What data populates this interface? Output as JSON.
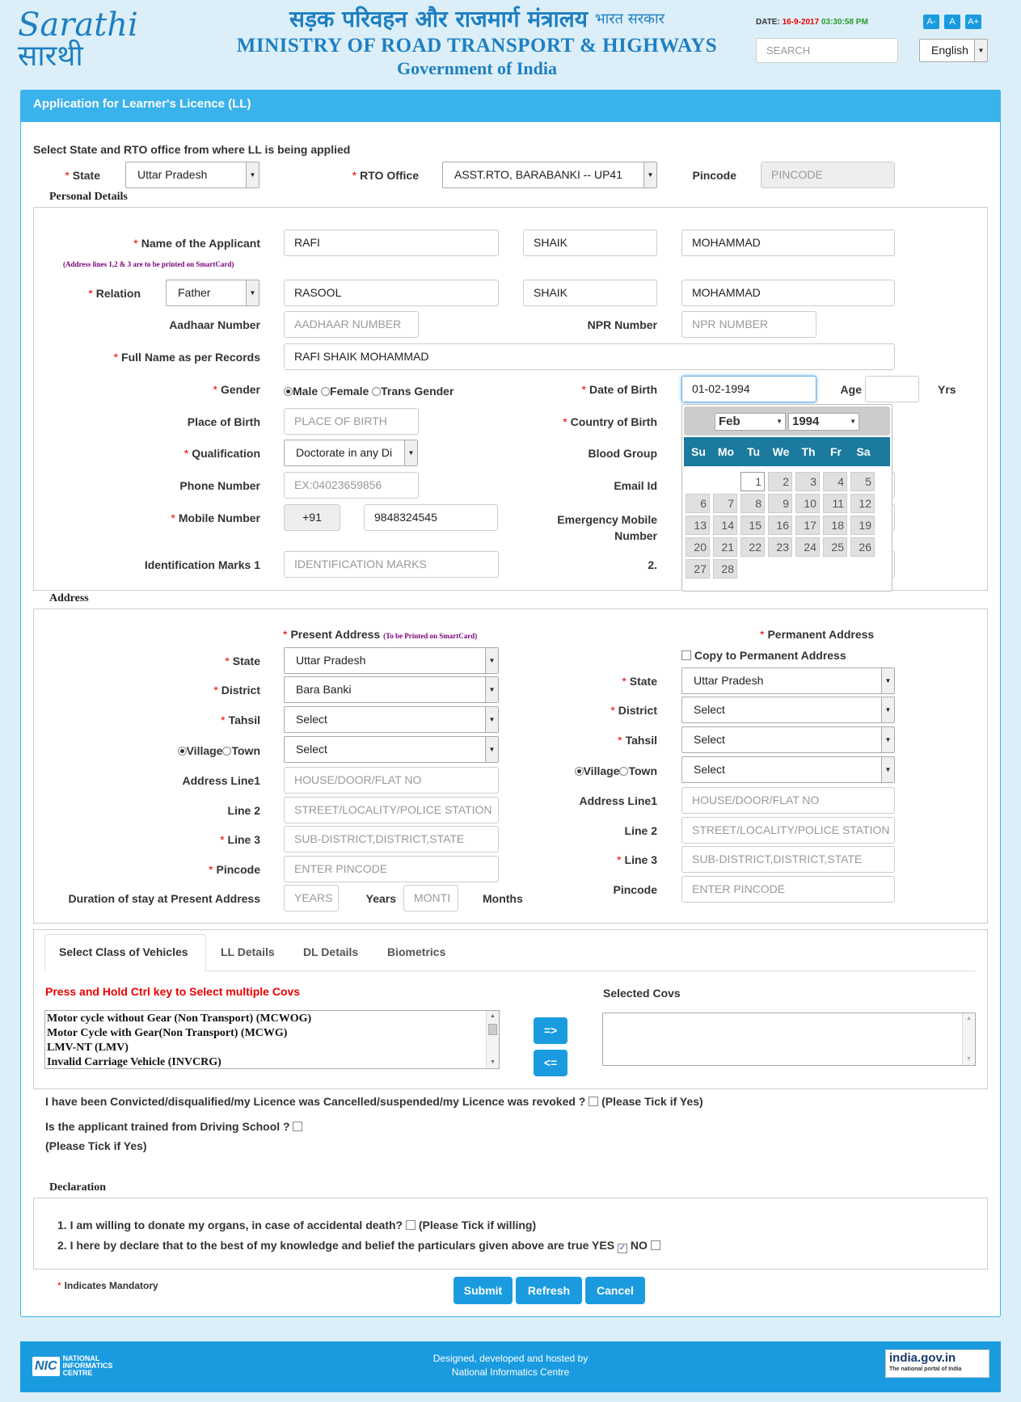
{
  "header": {
    "logo_latin": "Sarathi",
    "logo_hindi": "सारथी",
    "hindi_title": "सड़क परिवहन और राजमार्ग मंत्रालय",
    "hindi_gov": "भारत सरकार",
    "ministry": "MINISTRY OF ROAD TRANSPORT & HIGHWAYS",
    "gov": "Government of India",
    "date_label": "DATE:",
    "date_value": "16-9-2017",
    "time_value": "03:30:58 PM",
    "font_a_minus": "A-",
    "font_a": "A",
    "font_a_plus": "A+",
    "search_placeholder": "SEARCH",
    "language": "English"
  },
  "panel_title": "Application for Learner's Licence (LL)",
  "intro": "Select State and RTO office from where LL is being applied",
  "state_label": "State",
  "state_value": "Uttar Pradesh",
  "rto_label": "RTO Office",
  "rto_value": "ASST.RTO, BARABANKI -- UP41",
  "pincode_label": "Pincode",
  "pincode_placeholder": "PINCODE",
  "personal": {
    "legend": "Personal Details",
    "name_label": "Name of the Applicant",
    "name_note": "(Address lines 1,2 & 3 are to be printed on SmartCard)",
    "name_first": "RAFI",
    "name_middle": "SHAIK",
    "name_last": "MOHAMMAD",
    "relation_label": "Relation",
    "relation_value": "Father",
    "rel_first": "RASOOL",
    "rel_middle": "SHAIK",
    "rel_last": "MOHAMMAD",
    "aadhaar_label": "Aadhaar Number",
    "aadhaar_placeholder": "AADHAAR NUMBER",
    "npr_label": "NPR Number",
    "npr_placeholder": "NPR NUMBER",
    "fullname_label": "Full Name as per Records",
    "fullname_value": "RAFI SHAIK MOHAMMAD",
    "gender_label": "Gender",
    "gender_male": "Male",
    "gender_female": "Female",
    "gender_trans": "Trans Gender",
    "dob_label": "Date of Birth",
    "dob_value": "01-02-1994",
    "age_label": "Age",
    "yrs_label": "Yrs",
    "pob_label": "Place of Birth",
    "pob_placeholder": "PLACE OF BIRTH",
    "cob_label": "Country of Birth",
    "qual_label": "Qualification",
    "qual_value": "Doctorate in any Di",
    "blood_label": "Blood Group",
    "phone_label": "Phone Number",
    "phone_placeholder": "EX:04023659856",
    "email_label": "Email Id",
    "mobile_label": "Mobile Number",
    "mobile_code": "+91",
    "mobile_value": "9848324545",
    "emergency_label_1": "Emergency Mobile",
    "emergency_label_2": "Number",
    "idmarks_label": "Identification Marks 1",
    "idmarks_placeholder": "IDENTIFICATION MARKS",
    "idmarks2_label": "2."
  },
  "calendar": {
    "month": "Feb",
    "year": "1994",
    "days_header": [
      "Su",
      "Mo",
      "Tu",
      "We",
      "Th",
      "Fr",
      "Sa"
    ],
    "days": [
      "1",
      "2",
      "3",
      "4",
      "5",
      "6",
      "7",
      "8",
      "9",
      "10",
      "11",
      "12",
      "13",
      "14",
      "15",
      "16",
      "17",
      "18",
      "19",
      "20",
      "21",
      "22",
      "23",
      "24",
      "25",
      "26",
      "27",
      "28"
    ]
  },
  "address": {
    "legend": "Address",
    "present_title": "Present Address",
    "present_note": "(To be Printed on SmartCard)",
    "permanent_title": "Permanent Address",
    "copy_label": "Copy to Permanent Address",
    "state_label": "State",
    "district_label": "District",
    "tahsil_label": "Tahsil",
    "village_label": "Village",
    "town_label": "Town",
    "line1_label": "Address Line1",
    "line2_label": "Line 2",
    "line3_label": "Line 3",
    "pincode_label": "Pincode",
    "present_state": "Uttar Pradesh",
    "present_district": "Bara Banki",
    "present_tahsil": "Select",
    "present_village": "Select",
    "perm_state": "Uttar Pradesh",
    "perm_district": "Select",
    "perm_tahsil": "Select",
    "perm_village": "Select",
    "line1_placeholder": "HOUSE/DOOR/FLAT NO",
    "line2_placeholder": "STREET/LOCALITY/POLICE STATION",
    "line3_placeholder": "SUB-DISTRICT,DISTRICT,STATE",
    "pincode_placeholder": "ENTER PINCODE",
    "duration_label": "Duration of stay at Present Address",
    "years_placeholder": "YEARS",
    "years_label": "Years",
    "months_placeholder": "MONTI",
    "months_label": "Months"
  },
  "tabs": [
    "Select Class of Vehicles",
    "LL Details",
    "DL Details",
    "Biometrics"
  ],
  "cov": {
    "hint": "Press and Hold Ctrl key to Select multiple Covs",
    "selected_label": "Selected Covs",
    "options": [
      "Motor cycle without Gear (Non Transport) (MCWOG)",
      "Motor Cycle with Gear(Non Transport) (MCWG)",
      "LMV-NT (LMV)",
      "Invalid Carriage Vehicle (INVCRG)"
    ],
    "add_btn": "=>",
    "remove_btn": "<="
  },
  "convicted_text": "I have been Convicted/disqualified/my Licence was Cancelled/suspended/my Licence was revoked ?",
  "tick_if_yes": "(Please Tick if Yes)",
  "driving_school_text": "Is the applicant trained from Driving School ?",
  "declaration": {
    "legend": "Declaration",
    "line1": "1. I am willing to donate my organs, in case of accidental death?",
    "line1_hint": "(Please Tick if willing)",
    "line2": "2. I here by declare that to the best of my knowledge and belief the particulars given above are true YES",
    "no_label": "NO"
  },
  "mandatory_note": "Indicates Mandatory",
  "buttons": {
    "submit": "Submit",
    "refresh": "Refresh",
    "cancel": "Cancel"
  },
  "footer": {
    "nic_short": "NIC",
    "nic_lines": [
      "NATIONAL",
      "INFORMATICS",
      "CENTRE"
    ],
    "credit1": "Designed, developed and hosted by",
    "credit2": "National Informatics Centre",
    "india_gov": "india.gov.in",
    "india_gov_tag": "The national portal of India"
  },
  "colors": {
    "accent": "#1a9be0",
    "header_panel": "#3ab2ec",
    "calendar_header": "#1b7a9e",
    "required": "#e00000"
  }
}
